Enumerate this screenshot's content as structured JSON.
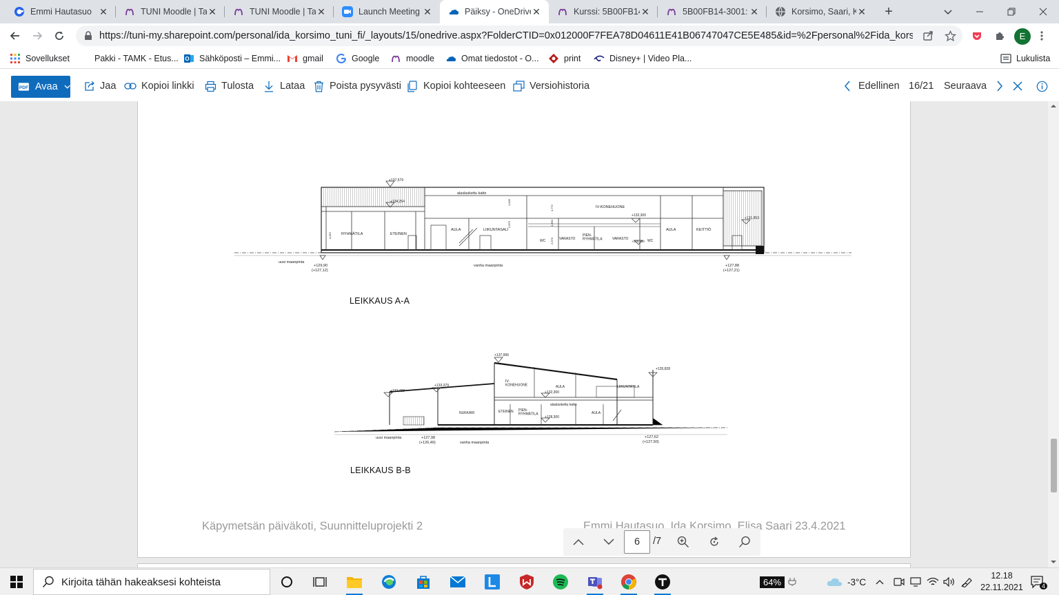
{
  "browser": {
    "tabs": [
      {
        "title": "Emmi Hautasuo",
        "icon": "edge-profile-icon",
        "active": false
      },
      {
        "title": "TUNI Moodle | Ta",
        "icon": "moodle-icon",
        "active": false
      },
      {
        "title": "TUNI Moodle | Ta",
        "icon": "moodle-icon",
        "active": false
      },
      {
        "title": "Launch Meeting",
        "icon": "zoom-icon",
        "active": false
      },
      {
        "title": "Päiksy - OneDrive",
        "icon": "onedrive-icon",
        "active": true
      },
      {
        "title": "Kurssi: 5B00FB14",
        "icon": "moodle-icon",
        "active": false
      },
      {
        "title": "5B00FB14-3001:",
        "icon": "moodle-icon",
        "active": false
      },
      {
        "title": "Korsimo, Saari, Ke",
        "icon": "globe-icon",
        "active": false
      }
    ],
    "url": "https://tuni-my.sharepoint.com/personal/ida_korsimo_tuni_fi/_layouts/15/onedrive.aspx?FolderCTID=0x012000F7FEA78D04611E41B06747047CE5E485&id=%2Fpersonal%2Fida_korsimo_tuni_...",
    "profile_initial": "E",
    "bookmarks": [
      {
        "label": "Sovellukset",
        "icon": "apps-grid-icon"
      },
      {
        "label": "Pakki - TAMK - Etus...",
        "icon": "none"
      },
      {
        "label": "Sähköposti – Emmi...",
        "icon": "outlook-icon"
      },
      {
        "label": "gmail",
        "icon": "gmail-icon"
      },
      {
        "label": "Google",
        "icon": "google-icon"
      },
      {
        "label": "moodle",
        "icon": "moodle-icon"
      },
      {
        "label": "Omat tiedostot - O...",
        "icon": "onedrive-icon"
      },
      {
        "label": "print",
        "icon": "print-bookmark-icon"
      },
      {
        "label": "Disney+ | Video Pla...",
        "icon": "disney-icon"
      }
    ],
    "reading_list": "Lukulista"
  },
  "commands": {
    "open": "Avaa",
    "share": "Jaa",
    "copy_link": "Kopioi linkki",
    "print": "Tulosta",
    "download": "Lataa",
    "delete": "Poista pysyvästi",
    "copy_to": "Kopioi kohteeseen",
    "version_history": "Versiohistoria",
    "previous": "Edellinen",
    "position": "16/21",
    "next": "Seuraava"
  },
  "document": {
    "section_a": {
      "title": "LEIKKAUS A-A",
      "labels": {
        "top_level": "+137,579",
        "roof_level": "+134,254",
        "ceiling": "alaslaskettu katto",
        "iv": "IV-KONEHUONE",
        "level_132": "+132,300",
        "level_131": "+131,853",
        "ryhmatila": "RYHMÄTILA",
        "eteinen": "ETEINEN",
        "aula1": "AULA",
        "liikuntasali": "LIIKUNTASALI",
        "wc1": "WC",
        "varasto1": "VARASTO",
        "pienryhmatila": "PIEN-\nRYHMÄTILA",
        "varasto2": "VARASTO",
        "wc2": "WC",
        "level_128": "+128,300",
        "aula2": "AULA",
        "keittio": "KEITTIÖ",
        "uusi": "uusi maanpinta",
        "vanha": "vanha maanpinta",
        "left_level": "+129,90",
        "left_level_old": "(+127,12)",
        "right_level": "+127,88",
        "right_level_old": "(+127,21)",
        "dim_1": "1,006",
        "dim_2": "4,772",
        "dim_3": "2,570",
        "dim_4": "4,452",
        "dim_5": "2,870",
        "dim_6": "4,850"
      }
    },
    "section_b": {
      "title": "LEIKKAUS B-B",
      "labels": {
        "top_level": "+137,996",
        "right_top": "+135,828",
        "left_top": "+133,379",
        "far_left": "+132,488",
        "iv": "IV-\nKONEHUONE",
        "aula1": "AULA",
        "liikuntatila": "LIIKUNTATILA",
        "level_132": "+132,300",
        "ceiling": "alaslaskettu katto",
        "nukkari": "NUKKARI",
        "eteinen": "ETEINEN",
        "pienryhmatila": "PIEN-\nRYHMÄTILA",
        "level_128": "+128,300",
        "aula2": "AULA",
        "uusi": "uusi maanpinta",
        "vanha": "vanha maanpinta",
        "left_level": "+127,98",
        "left_level_old": "(+126,49)",
        "right_level": "+127,62",
        "right_level_old": "(+127,50)"
      }
    },
    "footer_left": "Käpymetsän päiväkoti, Suunnitteluprojekti 2",
    "footer_right": "Emmi Hautasuo, Ida Korsimo, Elisa Saari 23.4.2021",
    "page_current": "6",
    "page_total": "/7"
  },
  "taskbar": {
    "search_placeholder": "Kirjoita tähän hakeaksesi kohteista",
    "battery": "64%",
    "temperature": "-3°C",
    "time": "12.18",
    "date": "22.11.2021",
    "notifications": "4"
  },
  "colors": {
    "accent": "#0f6cbd",
    "tabstrip": "#dee1e6",
    "footer_text": "#9a9a9a"
  }
}
